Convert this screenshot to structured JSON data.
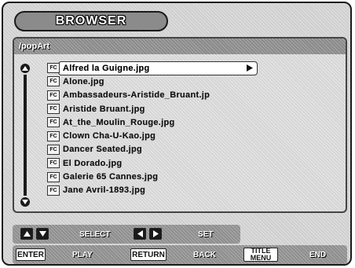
{
  "title": "BROWSER",
  "path": "/popArt",
  "files": [
    {
      "name": "Alfred la Guigne.jpg",
      "icon": "FC"
    },
    {
      "name": "Alone.jpg",
      "icon": "FC"
    },
    {
      "name": "Ambassadeurs-Aristide_Bruant.jp",
      "icon": "FC"
    },
    {
      "name": "Aristide Bruant.jpg",
      "icon": "FC"
    },
    {
      "name": "At_the_Moulin_Rouge.jpg",
      "icon": "FC"
    },
    {
      "name": "Clown Cha-U-Kao.jpg",
      "icon": "FC"
    },
    {
      "name": "Dancer Seated.jpg",
      "icon": "FC"
    },
    {
      "name": "El Dorado.jpg",
      "icon": "FC"
    },
    {
      "name": "Galerie 65 Cannes.jpg",
      "icon": "FC"
    },
    {
      "name": "Jane Avril-1893.jpg",
      "icon": "FC"
    }
  ],
  "selected_index": 0,
  "footer": {
    "select_label": "SELECT",
    "set_label": "SET",
    "enter_key": "ENTER",
    "play_label": "PLAY",
    "return_key": "RETURN",
    "back_label": "BACK",
    "title_menu_key_line1": "TITLE",
    "title_menu_key_line2": "MENU",
    "end_label": "END"
  }
}
